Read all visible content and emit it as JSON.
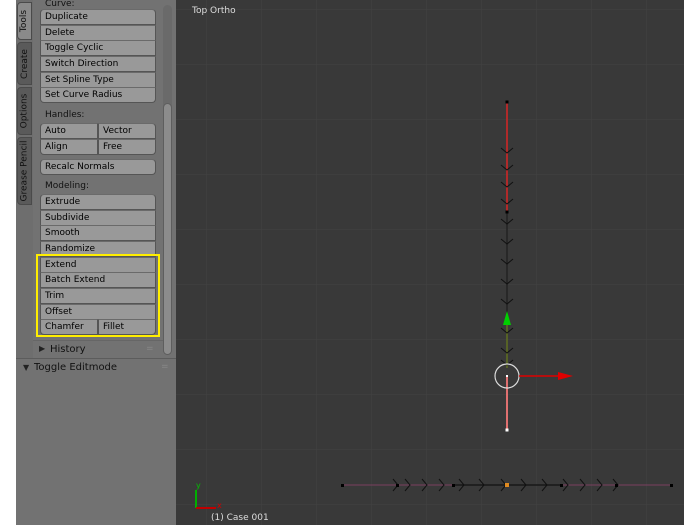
{
  "tabs": [
    "Tools",
    "Create",
    "Options",
    "Grease Pencil"
  ],
  "panel": {
    "curve_label": "Curve:",
    "curve_buttons": [
      "Duplicate",
      "Delete",
      "Toggle Cyclic",
      "Switch Direction",
      "Set Spline Type",
      "Set Curve Radius"
    ],
    "handles_label": "Handles:",
    "handles": [
      [
        "Auto",
        "Vector"
      ],
      [
        "Align",
        "Free"
      ]
    ],
    "recalc": "Recalc Normals",
    "modeling_label": "Modeling:",
    "modeling_buttons": [
      "Extrude",
      "Subdivide",
      "Smooth",
      "Randomize",
      "Extend",
      "Batch Extend",
      "Trim",
      "Offset"
    ],
    "chamfer": "Chamfer",
    "fillet": "Fillet",
    "history": "History",
    "toggle_editmode": "Toggle Editmode"
  },
  "viewport": {
    "title": "Top Ortho",
    "status": "(1) Case 001",
    "axis_x": "x",
    "axis_y": "y"
  },
  "colors": {
    "highlight": "#ffee00",
    "x_axis": "#e00000",
    "y_axis": "#00c000",
    "selected_point": "#e08a20"
  }
}
